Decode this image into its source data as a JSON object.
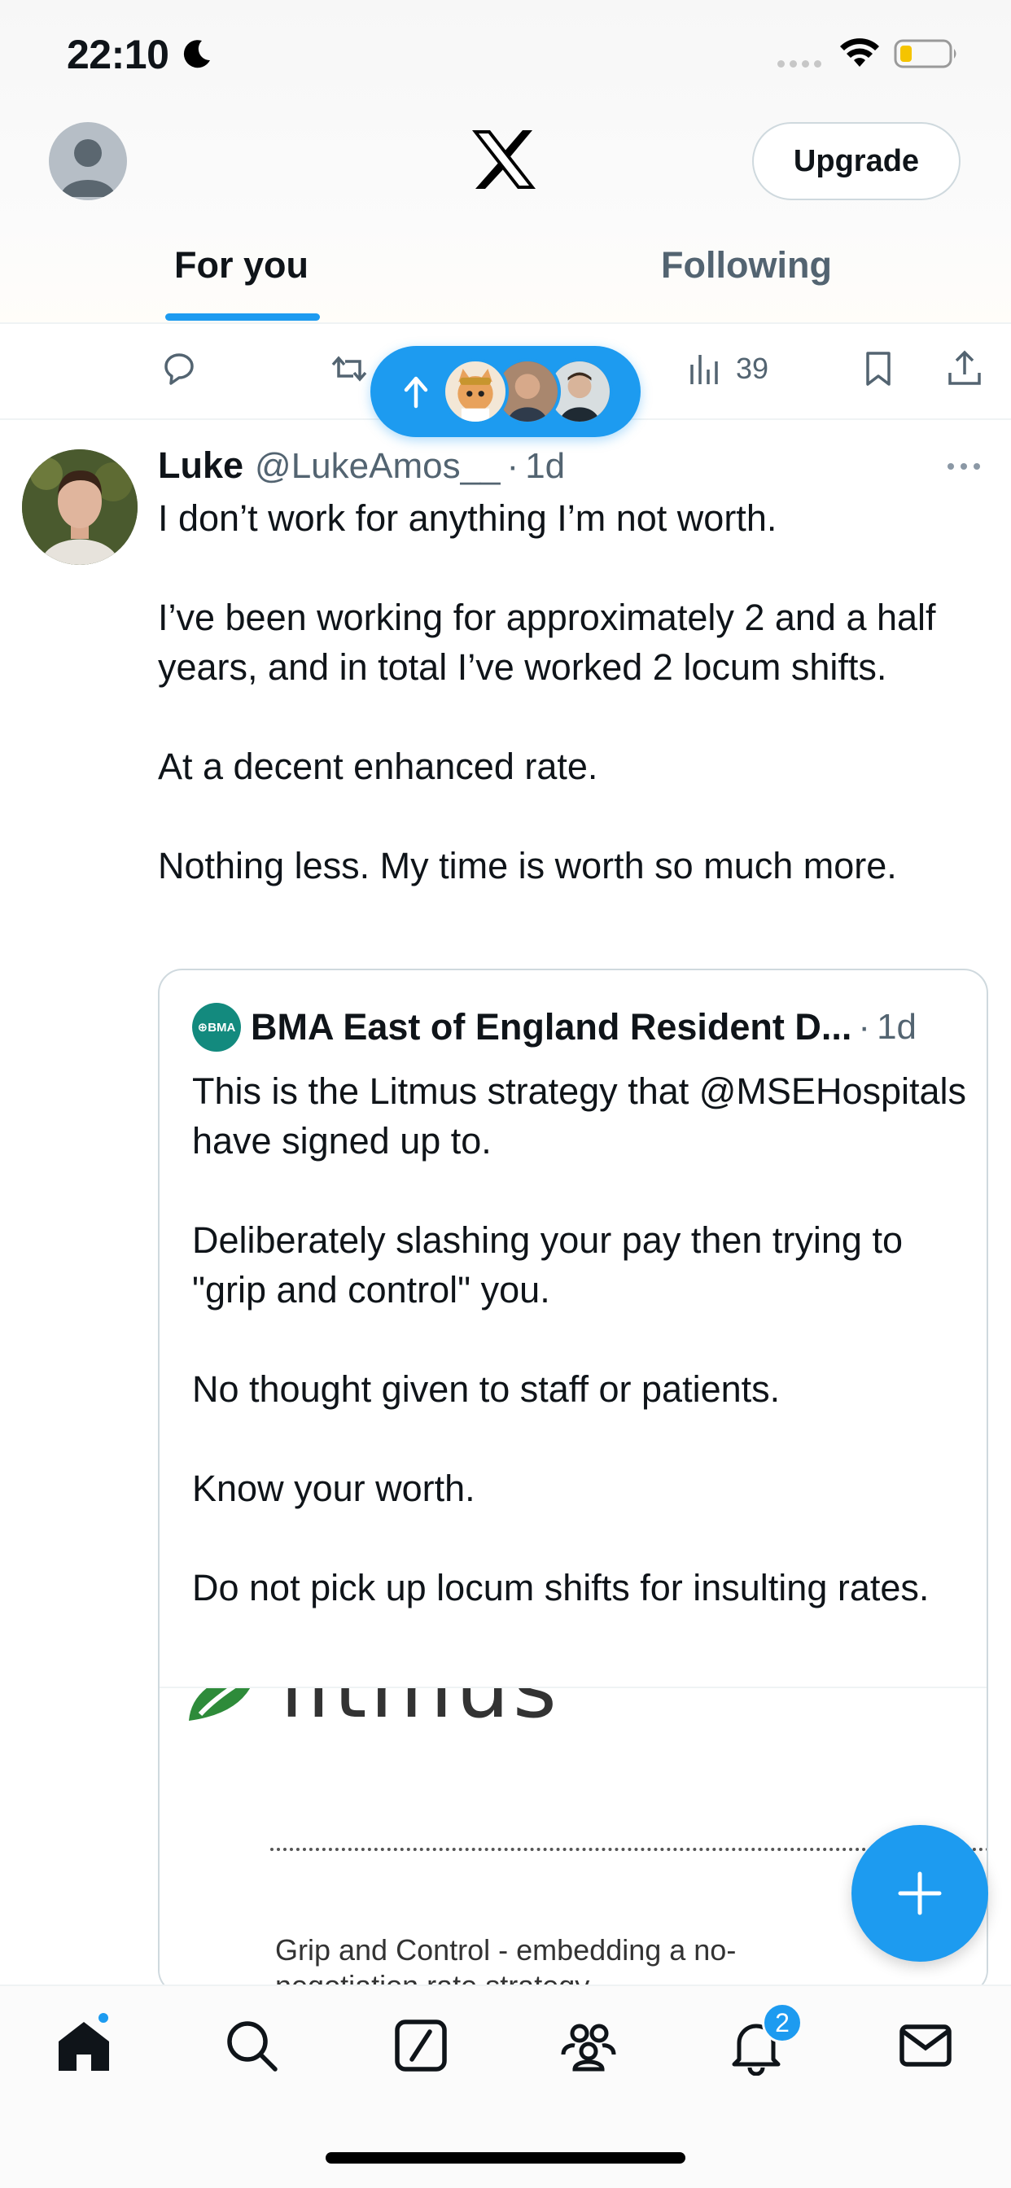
{
  "status_bar": {
    "time": "22:10",
    "battery_color": "#f5c400"
  },
  "header": {
    "upgrade_label": "Upgrade",
    "tabs": [
      {
        "label": "For you",
        "active": true
      },
      {
        "label": "Following",
        "active": false
      }
    ],
    "accent_color": "#1d9bf0"
  },
  "previous_tweet_actions": {
    "views": "39"
  },
  "tweet": {
    "display_name": "Luke",
    "handle": "@LukeAmos__",
    "separator": "·",
    "time": "1d",
    "body": [
      "I don’t work for anything I’m not worth.",
      "I’ve been working for approximately 2 and a half years, and in total I’ve worked 2 locum shifts.",
      "At a decent enhanced rate.",
      "Nothing less. My time is worth so much more."
    ]
  },
  "quoted_tweet": {
    "avatar_text": "⊕BMA",
    "display_name": "BMA East of England Resident D...",
    "separator": "·",
    "time": "1d",
    "body": [
      "This is the Litmus strategy that @MSEHospitals have signed up to.",
      "Deliberately slashing your pay then trying to \"grip and control\" you.",
      "No thought given to staff or patients.",
      "Know your worth.",
      "Do not pick up locum shifts for insulting rates."
    ],
    "image": {
      "logo_text": "litmus",
      "caption": "Grip and Control - embedding a no-negotiation rate strategy"
    }
  },
  "bottom_nav": {
    "items": [
      "home-icon",
      "search-icon",
      "grok-icon",
      "communities-icon",
      "notifications-icon",
      "messages-icon"
    ],
    "notifications_count": "2"
  }
}
